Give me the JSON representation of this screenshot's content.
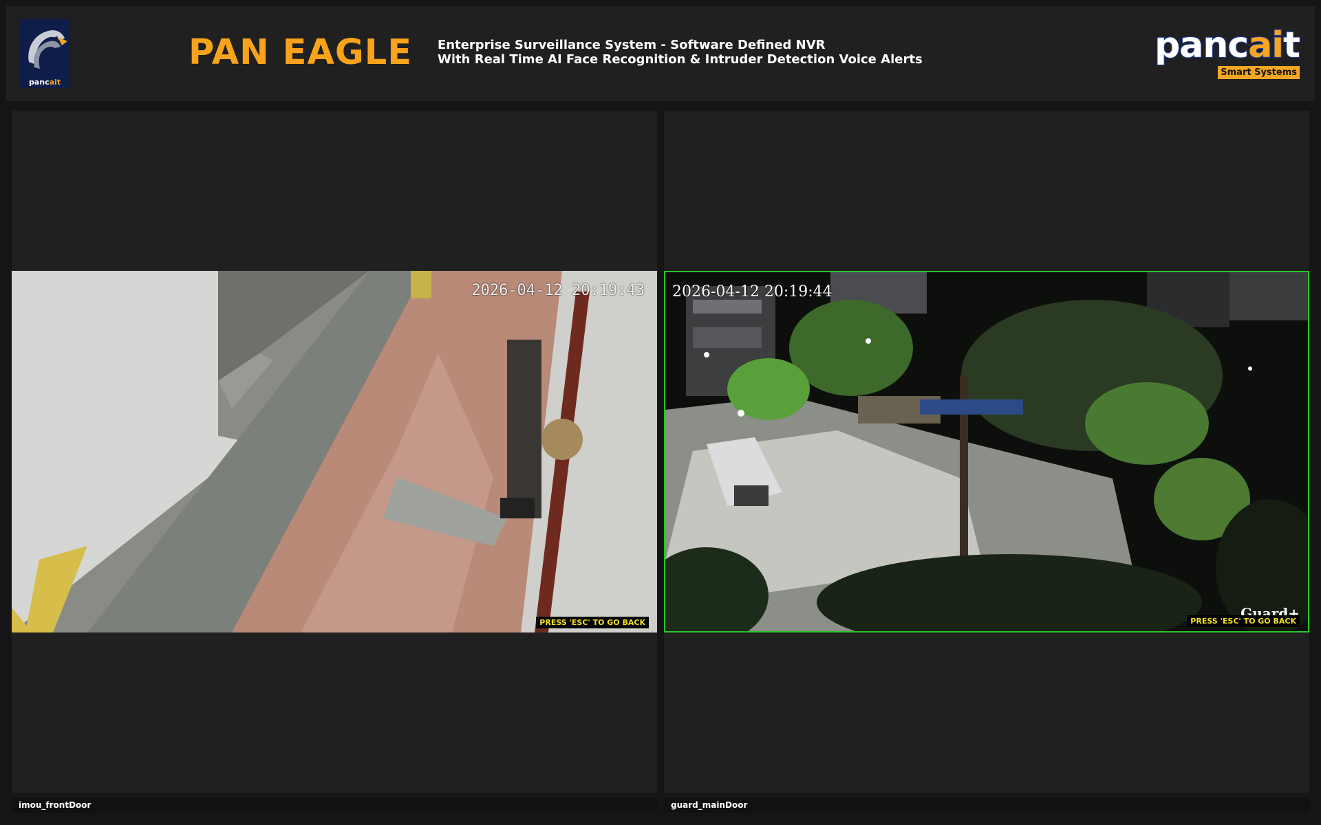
{
  "header": {
    "logo_text_a": "panc",
    "logo_text_b": "ait",
    "title": "PAN EAGLE",
    "subtitle_line1": "Enterprise Surveillance System - Software Defined NVR",
    "subtitle_line2": "With Real Time AI Face Recognition & Intruder Detection Voice Alerts",
    "brand_a": "panc",
    "brand_b": "ai",
    "brand_c": "t",
    "brand_tag": "Smart Systems"
  },
  "cameras": [
    {
      "name": "imou_frontDoor",
      "timestamp": "2026-04-12 20:19:43",
      "esc_hint": "PRESS 'ESC' TO GO BACK",
      "selected": false
    },
    {
      "name": "guard_mainDoor",
      "timestamp": "2026-04-12 20:19:44",
      "esc_hint": "PRESS 'ESC' TO GO BACK",
      "overlay_brand": "Guard+",
      "selected": true
    }
  ],
  "colors": {
    "accent": "#f9a21b",
    "selected_border": "#26c826",
    "esc_text": "#f2e21a"
  }
}
